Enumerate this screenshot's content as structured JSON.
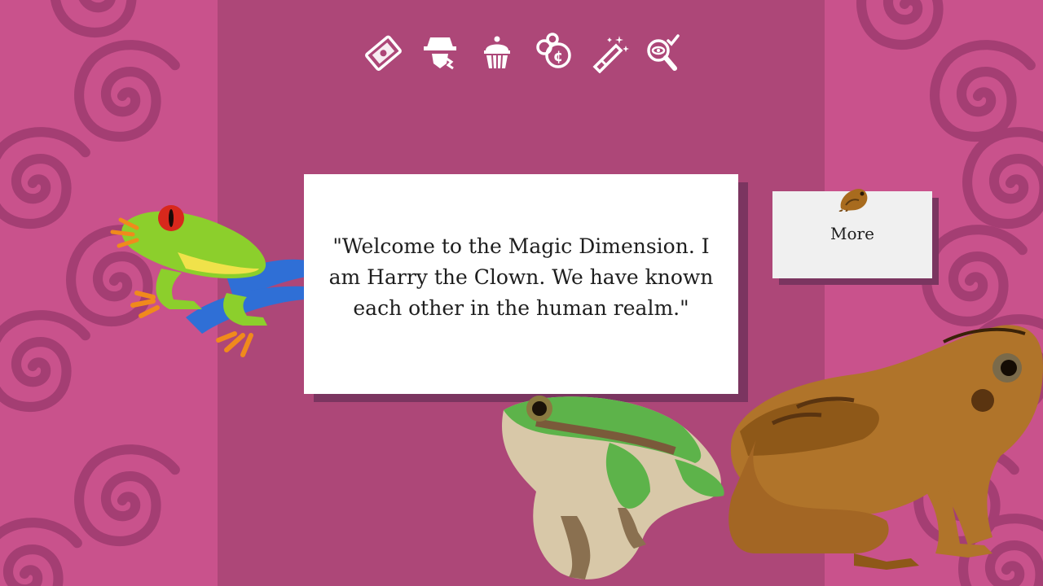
{
  "colors": {
    "outer_background": "#c9528c",
    "center_panel": "#ad4778",
    "spiral": "#a43e73",
    "dialog_background": "#ffffff",
    "dialog_shadow": "#7b3560",
    "button_background": "#f0f0f0",
    "text": "#1e1e1e"
  },
  "toolbar": {
    "items": [
      {
        "icon": "cards-tickets-icon"
      },
      {
        "icon": "detective-hat-icon"
      },
      {
        "icon": "cupcake-icon"
      },
      {
        "icon": "coins-icon"
      },
      {
        "icon": "magic-wand-icon"
      },
      {
        "icon": "magnifier-check-icon"
      }
    ]
  },
  "dialog": {
    "text": "\"Welcome to the Magic Dimension. I am Harry the Clown. We have known each other in the human realm.\""
  },
  "more_button": {
    "label": "More",
    "icon": "toad-icon"
  },
  "characters": [
    "red-eyed-tree-frog",
    "green-tree-frog",
    "brown-frog"
  ]
}
